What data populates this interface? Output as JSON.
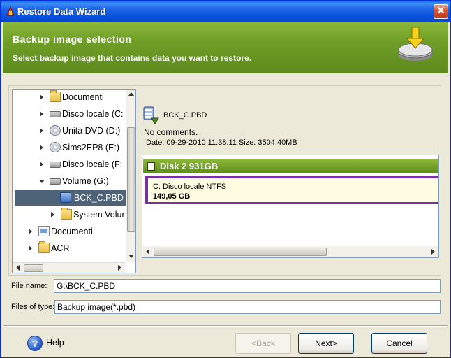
{
  "window": {
    "title": "Restore Data Wizard",
    "close_glyph": "✕"
  },
  "banner": {
    "title": "Backup image selection",
    "subtitle": "Select backup image that contains data you want to restore."
  },
  "tree": {
    "items": [
      {
        "label": "Documenti",
        "icon": "folder-icon",
        "expander": "collapsed"
      },
      {
        "label": "Disco locale (C:",
        "icon": "drive-icon",
        "expander": "collapsed"
      },
      {
        "label": "Unità DVD (D:)",
        "icon": "dvd-icon",
        "expander": "collapsed"
      },
      {
        "label": "Sims2EP8 (E:)",
        "icon": "dvd-icon",
        "expander": "collapsed"
      },
      {
        "label": "Disco locale (F:",
        "icon": "drive-icon",
        "expander": "collapsed"
      },
      {
        "label": "Volume (G:)",
        "icon": "drive-icon",
        "expander": "expanded"
      },
      {
        "label": "BCK_C.PBD",
        "icon": "backup-file-icon",
        "expander": "none",
        "selected": true
      },
      {
        "label": "System Volur",
        "icon": "folder-icon",
        "expander": "collapsed"
      },
      {
        "label": "Documenti",
        "icon": "documents-icon",
        "expander": "collapsed"
      },
      {
        "label": "ACR",
        "icon": "folder-icon",
        "expander": "collapsed"
      }
    ]
  },
  "image_info": {
    "file_name": "BCK_C.PBD",
    "comments": "No comments.",
    "details": "Date: 09-29-2010 11:38:11 Size: 3504.40MB"
  },
  "disk": {
    "header": "Disk 2  931GB",
    "partition": {
      "name": "C:  Disco locale  NTFS",
      "size": "149,05 GB"
    }
  },
  "form": {
    "file_name_label": "File name:",
    "file_name_value": "G:\\BCK_C.PBD",
    "file_type_label": "Files of type:",
    "file_type_value": "Backup image(*.pbd)"
  },
  "footer": {
    "help_label": "Help",
    "help_glyph": "?",
    "back_label": "<Back",
    "next_label": "Next>",
    "cancel_label": "Cancel"
  },
  "colors": {
    "title_bar": "#0A5FE8",
    "banner_green": "#6E9E27",
    "selection": "#4F6378",
    "partition_border": "#7A2FA8"
  }
}
